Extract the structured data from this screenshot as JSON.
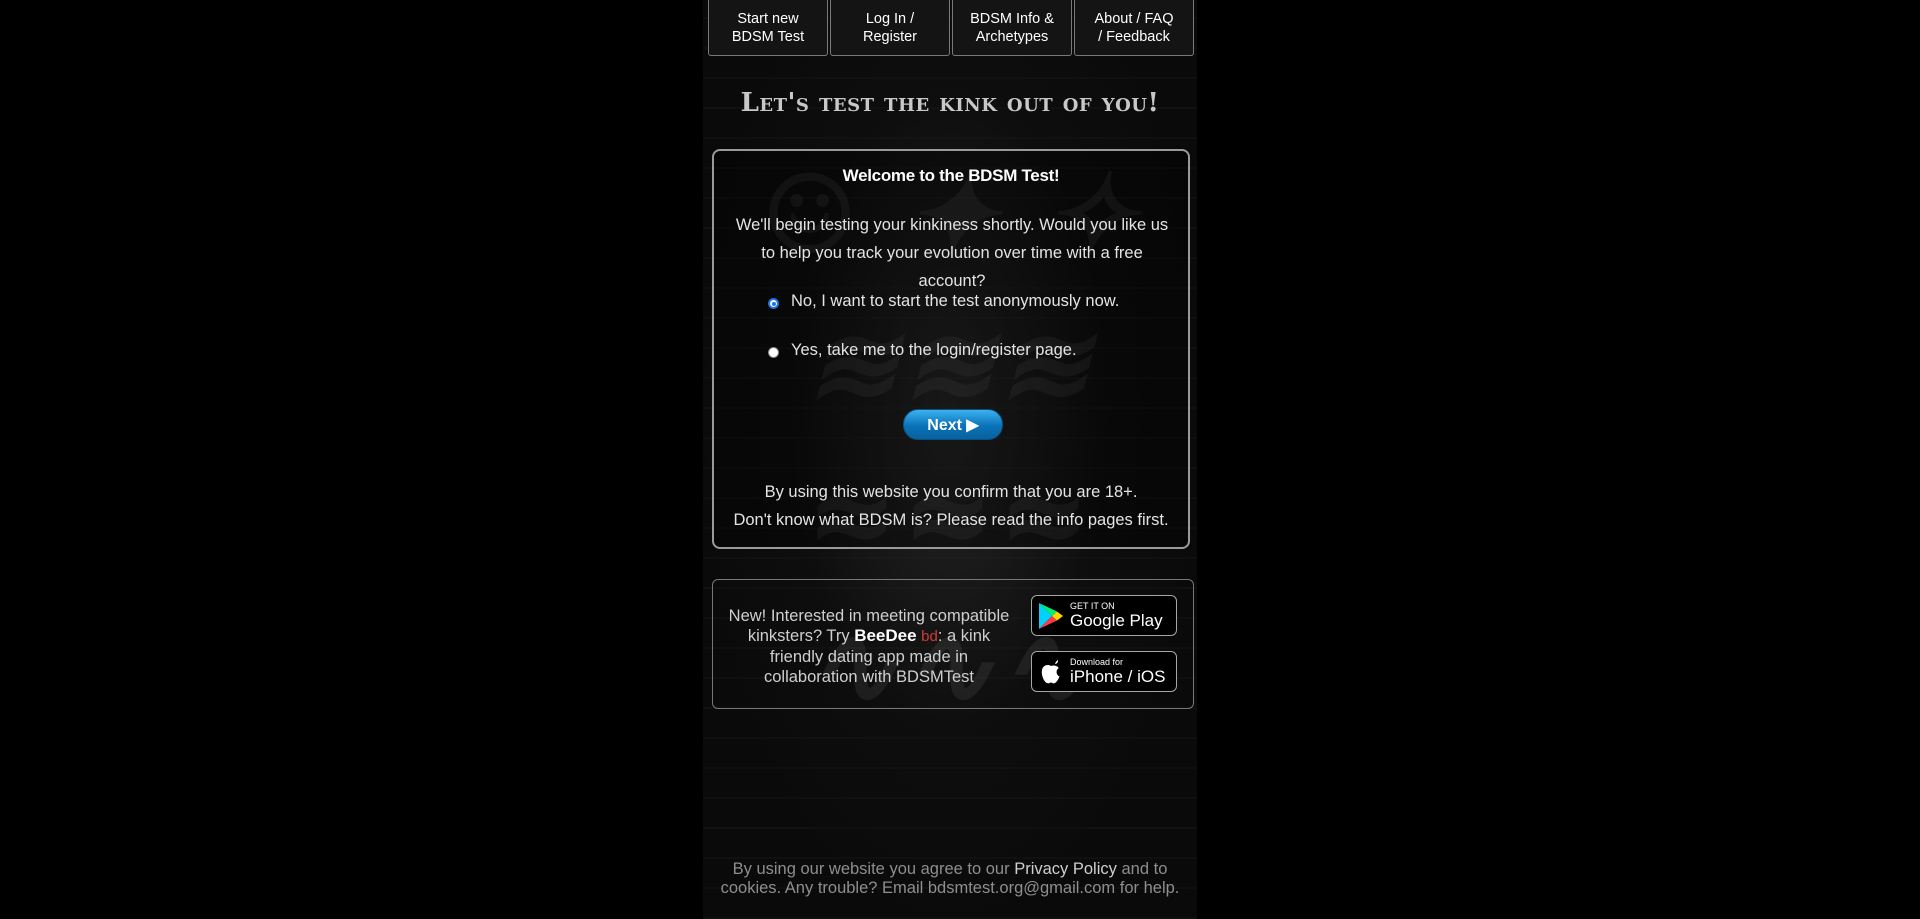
{
  "nav": {
    "items": [
      {
        "line1": "Start new",
        "line2": "BDSM Test"
      },
      {
        "line1": "Log In /",
        "line2": "Register"
      },
      {
        "line1": "BDSM Info &",
        "line2": "Archetypes"
      },
      {
        "line1": "About / FAQ",
        "line2": "/ Feedback"
      }
    ]
  },
  "headline": "Let's test the kink out of you!",
  "card": {
    "title": "Welcome to the BDSM Test!",
    "intro": "We'll begin testing your kinkiness shortly. Would you like us to help you track your evolution over time with a free account?",
    "options": [
      {
        "label": "No, I want to start the test anonymously now.",
        "checked": true
      },
      {
        "label": "Yes, take me to the login/register page.",
        "checked": false
      }
    ],
    "next_label": "Next ▶",
    "age_notice": "By using this website you confirm that you are 18+.",
    "info_notice": "Don't know what BDSM is? Please read the info pages first."
  },
  "promo": {
    "text_before": "New! Interested in meeting compatible kinksters? Try ",
    "brand": "BeeDee",
    "brand_glyph": "bd",
    "text_after": ": a kink friendly dating app made in collaboration with BDSMTest",
    "google": {
      "small": "GET IT ON",
      "big": "Google Play"
    },
    "apple": {
      "small": "Download for",
      "big": "iPhone / iOS"
    }
  },
  "footer": {
    "before": "By using our website you agree to our ",
    "link": "Privacy Policy",
    "after": " and to cookies. Any trouble? Email bdsmtest.org@gmail.com for help."
  },
  "colors": {
    "background": "#000000",
    "next_button": "#0a72b8",
    "radio_checked": "#1a73e8",
    "brand_glyph": "#d23b3b"
  }
}
